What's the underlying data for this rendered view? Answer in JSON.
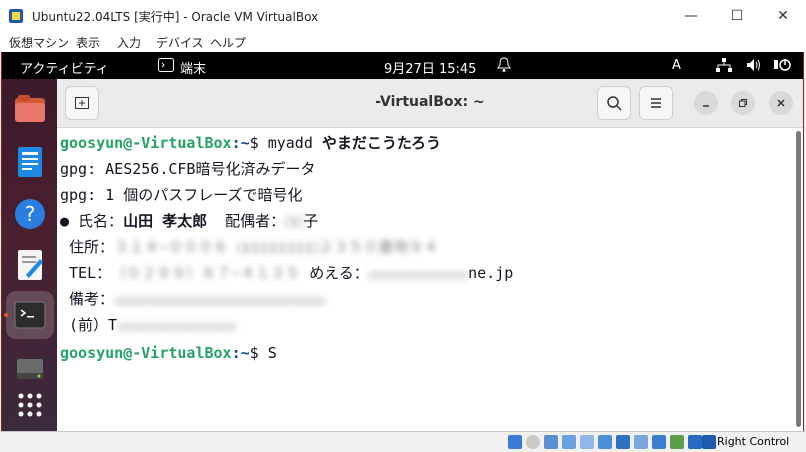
{
  "host": {
    "title": "Ubuntu22.04LTS [実行中] - Oracle VM VirtualBox",
    "menu": [
      "仮想マシン",
      "表示",
      "入力",
      "デバイス",
      "ヘルプ"
    ],
    "controls": {
      "minimize": "—",
      "maximize": "☐",
      "close": "✕"
    },
    "status_host_key": "Right Control"
  },
  "gnome": {
    "activities": "アクティビティ",
    "app_label": "端末",
    "clock": "9月27日 15:45",
    "input_method": "A"
  },
  "terminal": {
    "title": "-VirtualBox: ~",
    "lines": {
      "l1_user": "goosyun@",
      "l1_host": "-VirtualBox",
      "l1_path": ":~",
      "l1_cmd": "$ myadd ",
      "l1_arg": "やまだこうたろう",
      "l2": "gpg: AES256.CFB暗号化済みデータ",
      "l3": "gpg: 1 個のパスフレーズで暗号化",
      "l4_bullet": "● 氏名：",
      "l4_name": "山田 孝太郎",
      "l4_label2": "  配偶者：",
      "l4_blur": "□□",
      "l4_end": "子",
      "l5_label": " 住所：",
      "l5_blur": "３１４−０００６ □□□□□□□□□２３５０番地９４",
      "l6_label": " TEL：",
      "l6_blur": "（０２９９）８７−４１３５",
      "l6_label2": " めえる：",
      "l6_blur2": "□□□□□□□□□□□□□□□",
      "l6_end": "ne.jp",
      "l7_label": " 備考：",
      "l7_blur": "□□□□□□□□□□□□□□□□□□□□□□□□□□□□□□□□",
      "l8_label": " (前）T",
      "l8_blur": "□□□□□□□□□□□□□□□□□□",
      "l9_user": "goosyun@",
      "l9_host": "-VirtualBox",
      "l9_path": ":~",
      "l9_cmd": "$ S"
    }
  },
  "colors": {
    "prompt_green": "#26a269",
    "prompt_blue": "#12488b",
    "top_bar": "#000000",
    "accent": "#e95420"
  }
}
